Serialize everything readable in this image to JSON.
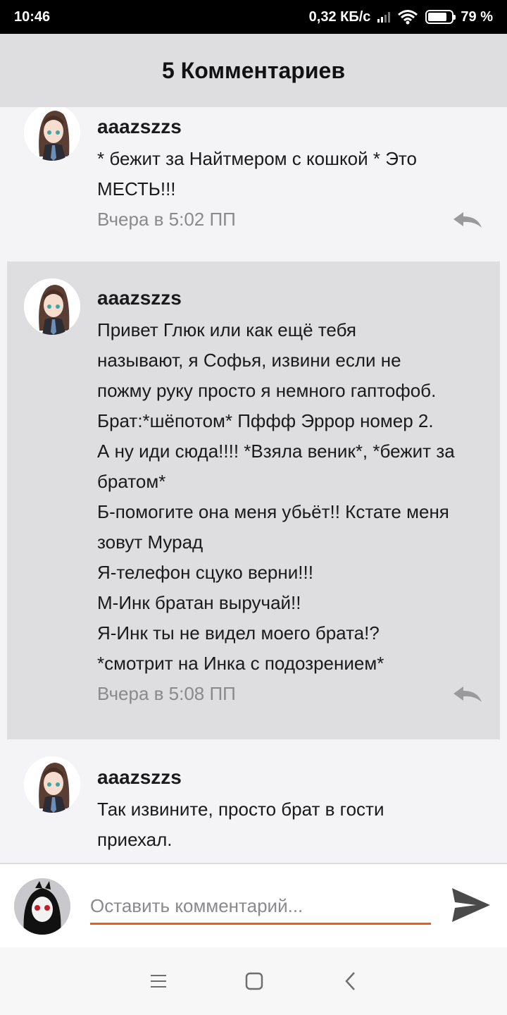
{
  "status_bar": {
    "time": "10:46",
    "network_speed": "0,32 КБ/с",
    "battery": "79 %",
    "battery_level": 0.79
  },
  "header": {
    "title": "5 Комментариев"
  },
  "comments": [
    {
      "author": "aaazszzs",
      "text": "* бежит за Найтмером с кошкой * Это\nМЕСТЬ!!!",
      "time": "Вчера в 5:02 ПП"
    },
    {
      "author": "aaazszzs",
      "text": "Привет Глюк или как ещё тебя\nназывают, я Софья, извини если не\nпожму руку просто я немного гаптофоб.\nБрат:*шёпотом* Пффф Эррор номер 2.\nА ну иди сюда!!!! *Взяла веник*, *бежит за\nбратом*\nБ-помогите она меня убьёт!! Кстате меня\nзовут Мурад\nЯ-телефон сцуко верни!!!\nМ-Инк братан выручай!!\nЯ-Инк ты не видел моего брата!?\n*смотрит на Инка с подозрением*",
      "time": "Вчера в 5:08 ПП"
    },
    {
      "author": "aaazszzs",
      "text": "Так извините, просто брат в гости\nприехал.",
      "time": ""
    }
  ],
  "input": {
    "placeholder": "Оставить комментарий...",
    "value": ""
  },
  "icons": {
    "reply": "reply-icon",
    "send": "send-icon",
    "menu": "menu-icon",
    "home": "home-icon",
    "back": "back-icon"
  },
  "colors": {
    "accent": "#ef5a14",
    "header_bg": "#dedde0",
    "page_bg": "#f4f3f6",
    "muted_text": "#8a898c"
  }
}
